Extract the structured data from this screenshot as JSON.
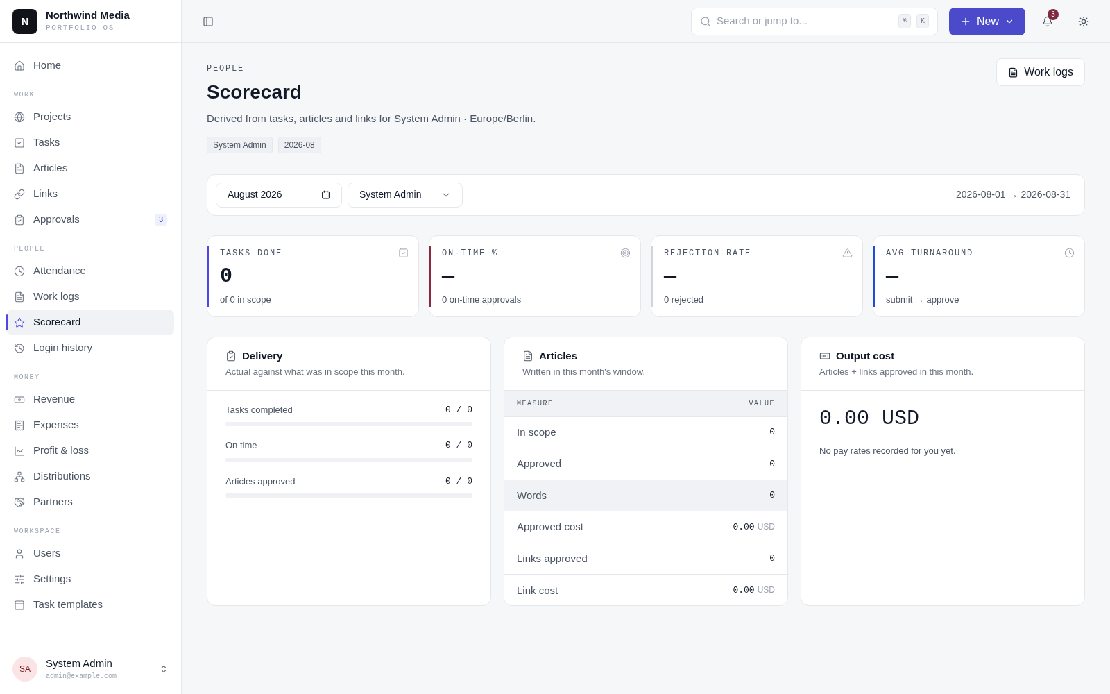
{
  "brand": {
    "logo": "N",
    "name": "Northwind Media",
    "tagline": "PORTFOLIO OS"
  },
  "sidebar": {
    "groups": [
      {
        "items": [
          {
            "label": "Home",
            "selected": false
          }
        ]
      },
      {
        "label": "WORK",
        "items": [
          {
            "label": "Projects",
            "selected": false
          },
          {
            "label": "Tasks",
            "selected": false
          },
          {
            "label": "Articles",
            "selected": false
          },
          {
            "label": "Links",
            "selected": false
          },
          {
            "label": "Approvals",
            "selected": false,
            "badge": "3"
          }
        ]
      },
      {
        "label": "PEOPLE",
        "items": [
          {
            "label": "Attendance",
            "selected": false
          },
          {
            "label": "Work logs",
            "selected": false
          },
          {
            "label": "Scorecard",
            "selected": true
          },
          {
            "label": "Login history",
            "selected": false
          }
        ]
      },
      {
        "label": "MONEY",
        "items": [
          {
            "label": "Revenue",
            "selected": false
          },
          {
            "label": "Expenses",
            "selected": false
          },
          {
            "label": "Profit & loss",
            "selected": false
          },
          {
            "label": "Distributions",
            "selected": false
          },
          {
            "label": "Partners",
            "selected": false
          }
        ]
      },
      {
        "label": "WORKSPACE",
        "items": [
          {
            "label": "Users",
            "selected": false
          },
          {
            "label": "Settings",
            "selected": false
          },
          {
            "label": "Task templates",
            "selected": false
          }
        ]
      }
    ]
  },
  "user": {
    "initials": "SA",
    "name": "System Admin",
    "email": "admin@example.com"
  },
  "topbar": {
    "search": {
      "placeholder": "Search or jump to...",
      "keys": [
        "⌘",
        "K"
      ]
    },
    "new_button": "New",
    "notifications": "3"
  },
  "page": {
    "eyebrow": "PEOPLE",
    "title": "Scorecard",
    "subtitle": "Derived from tasks, articles and links for System Admin · Europe/Berlin.",
    "tags": [
      "System Admin",
      "2026-08"
    ],
    "action": "Work logs"
  },
  "filters": {
    "month": "August 2026",
    "person": "System Admin",
    "range": "2026-08-01 → 2026-08-31"
  },
  "stats": [
    {
      "label": "TASKS DONE",
      "value": "0",
      "note": "of 0 in scope",
      "color": "#4f46e5"
    },
    {
      "label": "ON-TIME %",
      "value": "—",
      "note": "0 on-time approvals",
      "color": "#8b2942"
    },
    {
      "label": "REJECTION RATE",
      "value": "—",
      "note": "0 rejected",
      "color": "#d1d5db"
    },
    {
      "label": "AVG TURNAROUND",
      "value": "—",
      "note": "submit → approve",
      "color": "#1d4ed8"
    }
  ],
  "delivery": {
    "title": "Delivery",
    "subtitle": "Actual against what was in scope this month.",
    "rows": [
      {
        "label": "Tasks completed",
        "value": "0 / 0",
        "level": 0
      },
      {
        "label": "On time",
        "value": "0 / 0",
        "level": 0
      },
      {
        "label": "Articles approved",
        "value": "0 / 0",
        "level": 0
      }
    ]
  },
  "articles": {
    "title": "Articles",
    "subtitle": "Written in this month's window.",
    "columns": [
      "MEASURE",
      "VALUE"
    ],
    "rows": [
      {
        "measure": "In scope",
        "value": "0",
        "highlighted": false
      },
      {
        "measure": "Approved",
        "value": "0",
        "highlighted": false
      },
      {
        "measure": "Words",
        "value": "0",
        "highlighted": true
      },
      {
        "measure": "Approved cost",
        "value": "0.00",
        "unit": "USD",
        "highlighted": false
      },
      {
        "measure": "Links approved",
        "value": "0",
        "highlighted": false
      },
      {
        "measure": "Link cost",
        "value": "0.00",
        "unit": "USD",
        "highlighted": false
      }
    ]
  },
  "output": {
    "title": "Output cost",
    "subtitle": "Articles + links approved in this month.",
    "amount": "0.00 USD",
    "note": "No pay rates recorded for you yet."
  }
}
